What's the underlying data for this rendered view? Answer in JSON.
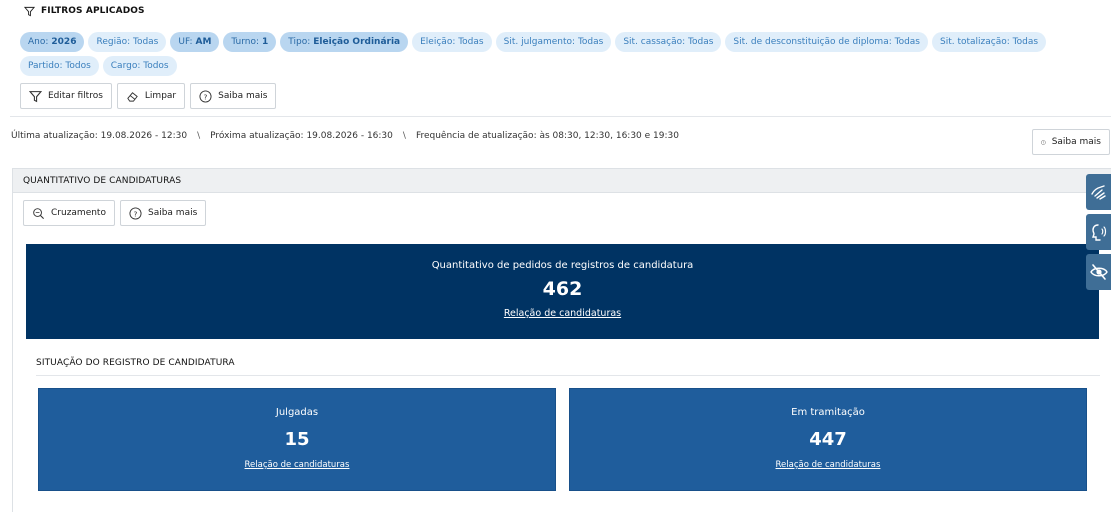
{
  "filters": {
    "title": "FILTROS APLICADOS",
    "chips": [
      {
        "label": "Ano:",
        "value": "2026",
        "active": true
      },
      {
        "label": "Região: Todas",
        "value": "",
        "active": false
      },
      {
        "label": "UF:",
        "value": "AM",
        "active": true
      },
      {
        "label": "Turno:",
        "value": "1",
        "active": true
      },
      {
        "label": "Tipo:",
        "value": "Eleição Ordinária",
        "active": true
      },
      {
        "label": "Eleição: Todas",
        "value": "",
        "active": false
      },
      {
        "label": "Sit. julgamento: Todas",
        "value": "",
        "active": false
      },
      {
        "label": "Sit. cassação: Todas",
        "value": "",
        "active": false
      },
      {
        "label": "Sit. de desconstituição de diploma: Todas",
        "value": "",
        "active": false
      },
      {
        "label": "Sit. totalização: Todas",
        "value": "",
        "active": false
      },
      {
        "label": "Partido: Todos",
        "value": "",
        "active": false
      },
      {
        "label": "Cargo: Todos",
        "value": "",
        "active": false
      }
    ],
    "edit_label": "Editar filtros",
    "clear_label": "Limpar",
    "help_label": "Saiba mais"
  },
  "update": {
    "last": "Última atualização: 19.08.2026 - 12:30",
    "next": "Próxima atualização: 19.08.2026 - 16:30",
    "frequency": "Frequência de atualização: às 08:30, 12:30, 16:30 e 19:30",
    "separator": "\\",
    "help_label": "Saiba mais"
  },
  "section": {
    "title": "QUANTITATIVO DE CANDIDATURAS",
    "cross_label": "Cruzamento",
    "help_label": "Saiba mais",
    "total": {
      "label": "Quantitativo de pedidos de registros de candidatura",
      "value": "462",
      "link": "Relação de candidaturas"
    },
    "status_title": "SITUAÇÃO DO REGISTRO DE CANDIDATURA",
    "judged": {
      "label": "Julgadas",
      "value": "15",
      "link": "Relação de candidaturas"
    },
    "in_progress": {
      "label": "Em tramitação",
      "value": "447",
      "link": "Relação de candidaturas"
    }
  },
  "colors": {
    "dark_card": "#003363",
    "blue_card": "#1f5d9c",
    "chip_bg": "#e0eefa",
    "side_tool": "#3f6e96"
  },
  "icons": {
    "filter": "filter-icon",
    "eraser": "eraser-icon",
    "help": "question-circle-icon",
    "search": "zoom-search-icon",
    "sign_language": "sign-language-icon",
    "voice": "speaking-head-icon",
    "visibility": "eye-slash-icon"
  }
}
